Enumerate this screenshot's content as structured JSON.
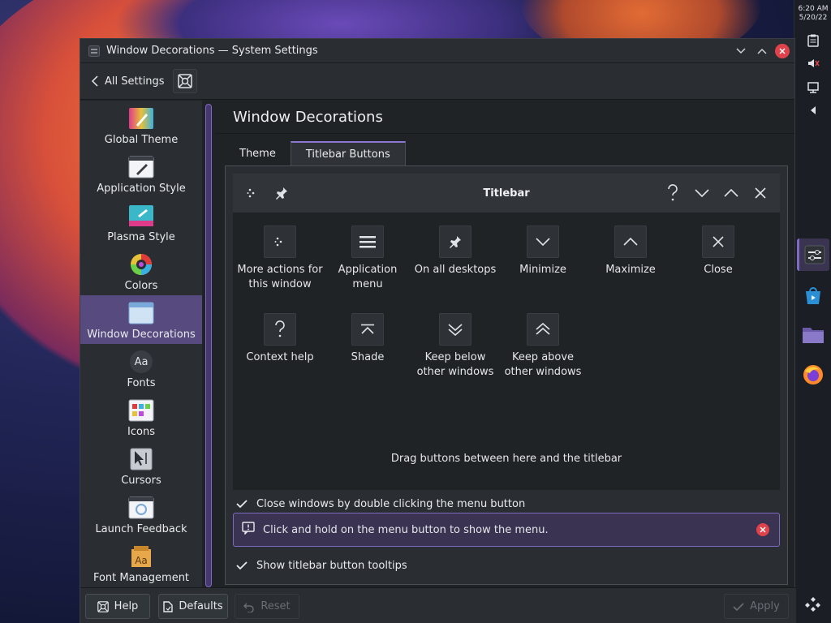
{
  "clock": {
    "time": "6:20 AM",
    "date": "5/20/22"
  },
  "window": {
    "title": "Window Decorations — System Settings"
  },
  "toolbar": {
    "back_label": "All Settings"
  },
  "sidebar": {
    "items": [
      {
        "label": "Global Theme"
      },
      {
        "label": "Application Style"
      },
      {
        "label": "Plasma Style"
      },
      {
        "label": "Colors"
      },
      {
        "label": "Window Decorations",
        "active": true
      },
      {
        "label": "Fonts"
      },
      {
        "label": "Icons"
      },
      {
        "label": "Cursors"
      },
      {
        "label": "Launch Feedback"
      },
      {
        "label": "Font Management"
      }
    ]
  },
  "page": {
    "title": "Window Decorations"
  },
  "tabs": [
    {
      "label": "Theme"
    },
    {
      "label": "Titlebar Buttons",
      "active": true
    }
  ],
  "preview": {
    "title": "Titlebar",
    "fonts_icon_text": "Aa"
  },
  "palette": {
    "items": [
      {
        "label": "More actions for this window",
        "icon": "more-actions-icon"
      },
      {
        "label": "Application menu",
        "icon": "hamburger-menu-icon"
      },
      {
        "label": "On all desktops",
        "icon": "pin-icon"
      },
      {
        "label": "Minimize",
        "icon": "chevron-down-icon"
      },
      {
        "label": "Maximize",
        "icon": "chevron-up-icon"
      },
      {
        "label": "Close",
        "icon": "close-icon"
      },
      {
        "label": "Context help",
        "icon": "help-icon"
      },
      {
        "label": "Shade",
        "icon": "shade-icon"
      },
      {
        "label": "Keep below other windows",
        "icon": "keep-below-icon"
      },
      {
        "label": "Keep above other windows",
        "icon": "keep-above-icon"
      }
    ],
    "hint": "Drag buttons between here and the titlebar"
  },
  "options": {
    "close_double_click": "Close windows by double clicking the menu button",
    "info_message": "Click and hold on the menu button to show the menu.",
    "show_tooltips": "Show titlebar button tooltips"
  },
  "buttons": {
    "help": "Help",
    "defaults": "Defaults",
    "reset": "Reset",
    "apply": "Apply"
  },
  "colors": {
    "accent": "#7e6cc4",
    "close": "#e0424b",
    "selection": "#574a7f"
  }
}
